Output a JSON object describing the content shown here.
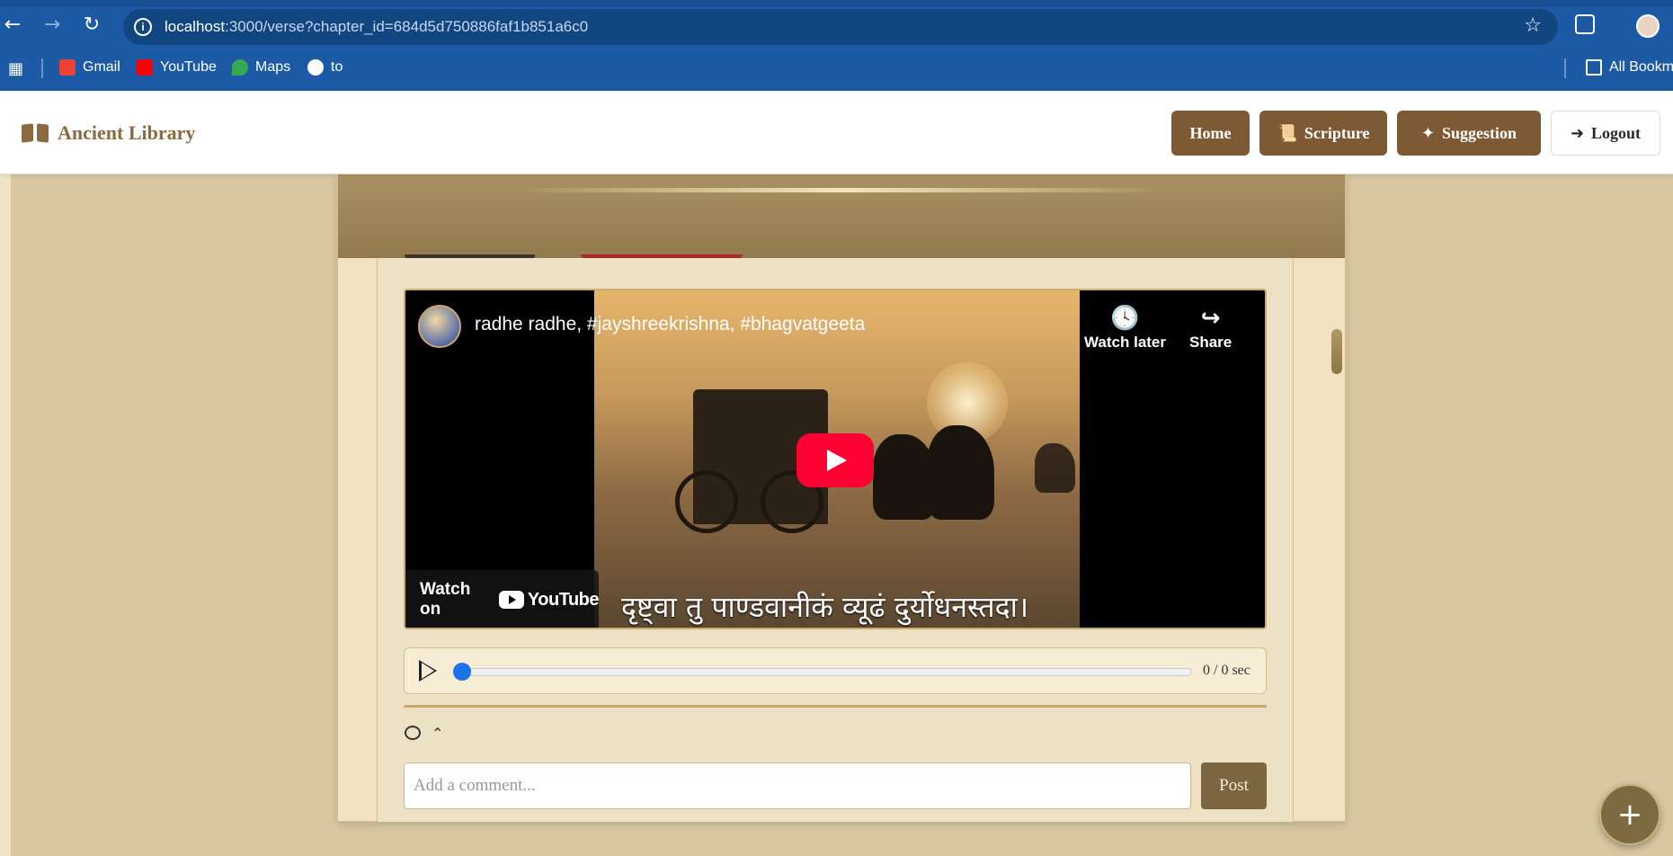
{
  "browser": {
    "url_host": "localhost",
    "url_rest": ":3000/verse?chapter_id=684d5d750886faf1b851a6c0",
    "bookmarks": [
      {
        "label": "Gmail",
        "color": "#ea4335"
      },
      {
        "label": "YouTube",
        "color": "#ff0000"
      },
      {
        "label": "Maps",
        "color": "#34a853"
      },
      {
        "label": "to",
        "color": "#ffffff"
      }
    ],
    "all_bookmarks": "All Bookm"
  },
  "header": {
    "brand": "Ancient Library",
    "nav": {
      "home": "Home",
      "scripture": "Scripture",
      "suggestion": "Suggestion",
      "logout": "Logout"
    }
  },
  "video": {
    "title": "radhe radhe, #jayshreekrishna, #bhagvatgeeta",
    "watch_later": "Watch later",
    "share": "Share",
    "watch_on": "Watch on",
    "youtube": "YouTube",
    "caption": "दृष्ट्वा तु पाण्डवानीकं व्यूढं दुर्योधनस्तदा।"
  },
  "audio": {
    "time": "0 / 0 sec",
    "progress": 0
  },
  "comments": {
    "placeholder": "Add a comment...",
    "post_label": "Post"
  },
  "colors": {
    "accent": "#7d5a34",
    "brand": "#8b6a3f",
    "chrome": "#1c5aa5"
  }
}
